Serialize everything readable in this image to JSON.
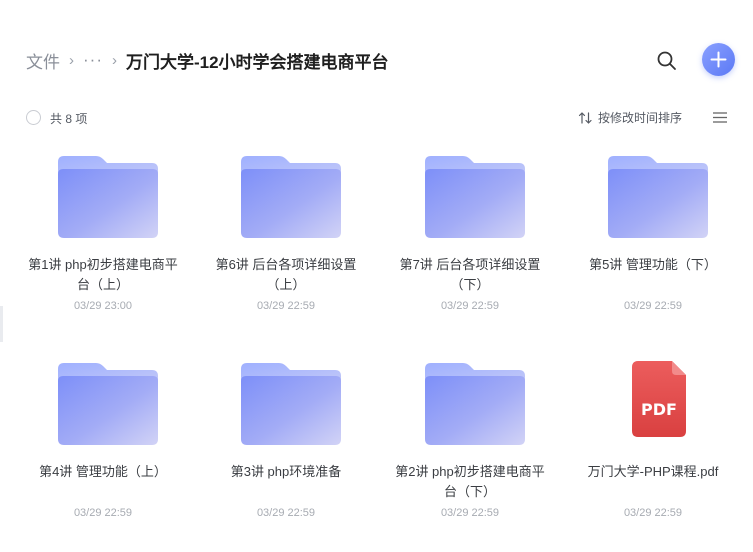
{
  "breadcrumb": {
    "root": "文件",
    "separator": "›",
    "more": "···",
    "current": "万门大学-12小时学会搭建电商平台"
  },
  "toolbar": {
    "count": "共 8 项",
    "sort_label": "按修改时间排序"
  },
  "colors": {
    "accent": "#5b79f5",
    "folder_front": "#8c9cff",
    "folder_back": "#a9b6ff",
    "pdf_red": "#e24b4b"
  },
  "files": [
    {
      "type": "folder-icon",
      "name": "第1讲 php初步搭建电商平台（上）",
      "date": "03/29 23:00"
    },
    {
      "type": "folder-icon",
      "name": "第6讲 后台各项详细设置（上）",
      "date": "03/29 22:59"
    },
    {
      "type": "folder-icon",
      "name": "第7讲 后台各项详细设置（下）",
      "date": "03/29 22:59"
    },
    {
      "type": "folder-icon",
      "name": "第5讲 管理功能（下）",
      "date": "03/29 22:59"
    },
    {
      "type": "folder-icon",
      "name": "第4讲 管理功能（上）",
      "date": "03/29 22:59"
    },
    {
      "type": "folder-icon",
      "name": "第3讲 php环境准备",
      "date": "03/29 22:59"
    },
    {
      "type": "folder-icon",
      "name": "第2讲 php初步搭建电商平台（下）",
      "date": "03/29 22:59"
    },
    {
      "type": "pdf-icon",
      "name": "万门大学-PHP课程.pdf",
      "date": "03/29 22:59",
      "badge": "PDF"
    }
  ]
}
